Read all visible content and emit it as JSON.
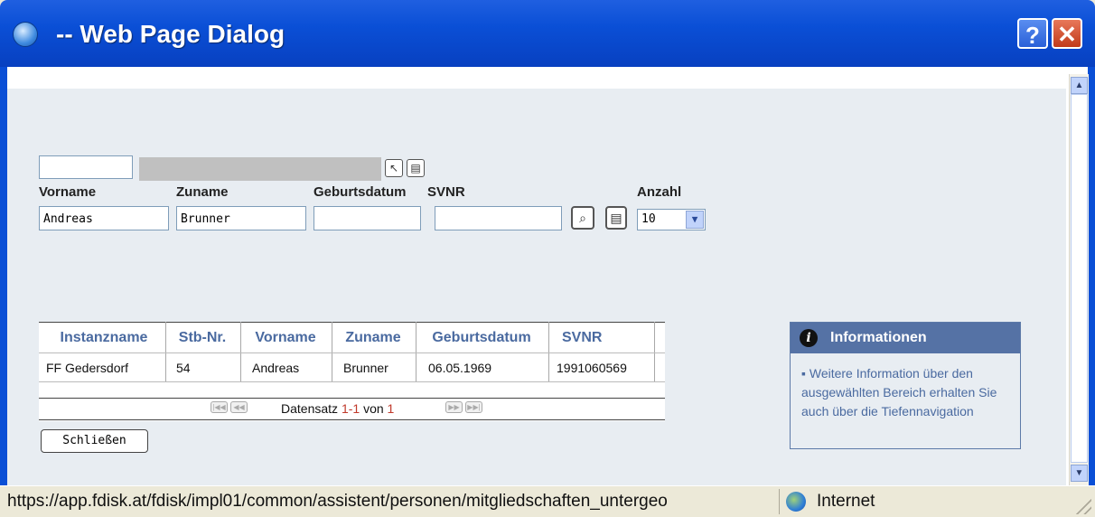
{
  "window": {
    "title": "-- Web Page Dialog",
    "help_label": "?",
    "close_label": "✕"
  },
  "search": {
    "code_value": "",
    "vorname_label": "Vorname",
    "zuname_label": "Zuname",
    "geburtsdatum_label": "Geburtsdatum",
    "svnr_label": "SVNR",
    "anzahl_label": "Anzahl",
    "vorname_value": "Andreas",
    "zuname_value": "Brunner",
    "geburtsdatum_value": "",
    "svnr_value": "",
    "anzahl_selected": "10"
  },
  "icons": {
    "picker": "pointer-icon",
    "list_small": "list-icon",
    "search": "magnifier-icon",
    "list": "list-icon"
  },
  "table": {
    "columns": [
      "Instanzname",
      "Stb-Nr.",
      "Vorname",
      "Zuname",
      "Geburtsdatum",
      "SVNR"
    ],
    "rows": [
      [
        "FF Gedersdorf",
        "54",
        "Andreas",
        "Brunner",
        "06.05.1969",
        "1991060569"
      ]
    ],
    "pager": {
      "prefix": "Datensatz",
      "range": "1-1",
      "of_label": "von",
      "total": "1"
    }
  },
  "close_button_label": "Schließen",
  "info": {
    "title": "Informationen",
    "text": "Weitere Information über den ausgewählten Bereich erhalten Sie auch über die Tiefennavigation"
  },
  "statusbar": {
    "url": "https://app.fdisk.at/fdisk/impl01/common/assistent/personen/mitgliedschaften_untergeo",
    "zone": "Internet"
  },
  "colors": {
    "titlebar": "#0a4fd6",
    "header_text": "#4a6aa0",
    "accent_red": "#c0392b",
    "info_header": "#5572a5"
  }
}
